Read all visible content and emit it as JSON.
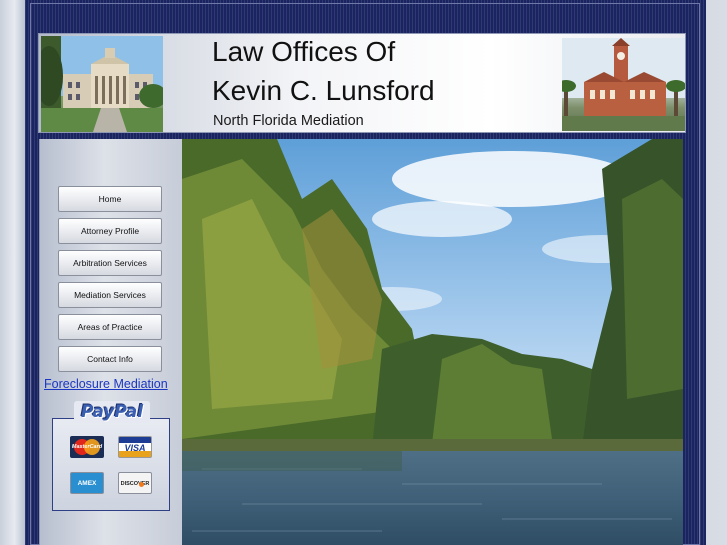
{
  "header": {
    "title_line1": "Law Offices Of",
    "title_line2": "Kevin C. Lunsford",
    "subtitle": "North Florida Mediation"
  },
  "nav": {
    "items": [
      {
        "label": "Home"
      },
      {
        "label": "Attorney Profile"
      },
      {
        "label": "Arbitration Services"
      },
      {
        "label": "Mediation Services"
      },
      {
        "label": "Areas of Practice"
      },
      {
        "label": "Contact Info"
      }
    ]
  },
  "links": {
    "foreclosure": "Foreclosure Mediation"
  },
  "payment": {
    "paypal_label": "PayPal",
    "cards": [
      "MasterCard",
      "VISA",
      "AMEX",
      "DISCOVER"
    ]
  },
  "colors": {
    "frame": "#1a2460",
    "link": "#1b36c2",
    "sidebar": "#dde1e8"
  }
}
